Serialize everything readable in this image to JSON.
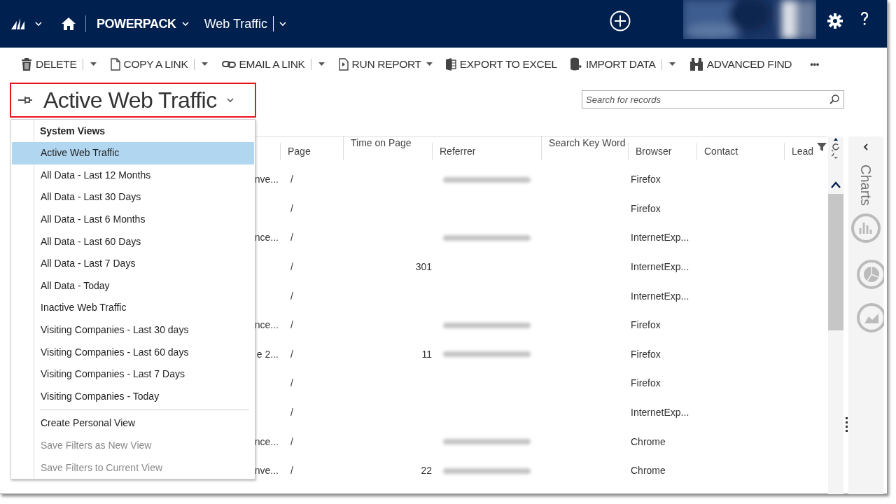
{
  "nav": {
    "app": "POWERPACK",
    "area": "Web Traffic"
  },
  "commands": [
    {
      "label": "DELETE",
      "split": true,
      "caret": false
    },
    {
      "label": "COPY A LINK",
      "split": true,
      "caret": false
    },
    {
      "label": "EMAIL A LINK",
      "split": true,
      "caret": false
    },
    {
      "label": "RUN REPORT",
      "split": false,
      "caret": true
    },
    {
      "label": "EXPORT TO EXCEL",
      "split": false,
      "caret": false
    },
    {
      "label": "IMPORT DATA",
      "split": true,
      "caret": false
    },
    {
      "label": "ADVANCED FIND",
      "split": false,
      "caret": false
    }
  ],
  "more": "•••",
  "view_title": "Active Web Traffic",
  "search": {
    "placeholder": "Search for records"
  },
  "columns": [
    "Page",
    "Time on Page",
    "Referrer",
    "Search Key Word",
    "Browser",
    "Contact",
    "Lead"
  ],
  "rows": [
    {
      "name": "nve...",
      "page": "/",
      "time": "",
      "referrer_blurred": true,
      "browser": "Firefox"
    },
    {
      "name": "",
      "page": "/",
      "time": "",
      "referrer_blurred": false,
      "browser": "Firefox"
    },
    {
      "name": "nce...",
      "page": "/",
      "time": "",
      "referrer_blurred": true,
      "browser": "InternetExp..."
    },
    {
      "name": "",
      "page": "/",
      "time": "301",
      "referrer_blurred": false,
      "browser": "InternetExp..."
    },
    {
      "name": "",
      "page": "/",
      "time": "",
      "referrer_blurred": false,
      "browser": "InternetExp..."
    },
    {
      "name": "nce...",
      "page": "/",
      "time": "",
      "referrer_blurred": true,
      "browser": "Firefox"
    },
    {
      "name": "e 2...",
      "page": "/",
      "time": "11",
      "referrer_blurred": true,
      "browser": "Firefox"
    },
    {
      "name": "",
      "page": "/",
      "time": "",
      "referrer_blurred": false,
      "browser": "Firefox"
    },
    {
      "name": "",
      "page": "/",
      "time": "",
      "referrer_blurred": false,
      "browser": "InternetExp..."
    },
    {
      "name": "nce...",
      "page": "/",
      "time": "",
      "referrer_blurred": true,
      "browser": "Chrome"
    },
    {
      "name": "nve...",
      "page": "/",
      "time": "22",
      "referrer_blurred": true,
      "browser": "Chrome"
    }
  ],
  "view_menu": {
    "groups": [
      {
        "header": "System Views",
        "items": [
          {
            "label": "Active Web Traffic",
            "selected": true,
            "disabled": false
          },
          {
            "label": "All Data - Last 12 Months",
            "selected": false,
            "disabled": false
          },
          {
            "label": "All Data - Last 30 Days",
            "selected": false,
            "disabled": false
          },
          {
            "label": "All Data - Last 6 Months",
            "selected": false,
            "disabled": false
          },
          {
            "label": "All Data - Last 60 Days",
            "selected": false,
            "disabled": false
          },
          {
            "label": "All Data - Last 7 Days",
            "selected": false,
            "disabled": false
          },
          {
            "label": "All Data - Today",
            "selected": false,
            "disabled": false
          },
          {
            "label": "Inactive Web Traffic",
            "selected": false,
            "disabled": false
          },
          {
            "label": "Visiting Companies - Last 30 days",
            "selected": false,
            "disabled": false
          },
          {
            "label": "Visiting Companies - Last 60 days",
            "selected": false,
            "disabled": false
          },
          {
            "label": "Visiting Companies - Last 7 Days",
            "selected": false,
            "disabled": false
          },
          {
            "label": "Visiting Companies - Today",
            "selected": false,
            "disabled": false
          }
        ]
      },
      {
        "items": [
          {
            "label": "Create Personal View",
            "selected": false,
            "disabled": false
          },
          {
            "label": "Save Filters as New View",
            "selected": false,
            "disabled": true
          },
          {
            "label": "Save Filters to Current View",
            "selected": false,
            "disabled": true
          }
        ]
      }
    ]
  },
  "charts_pane": {
    "title": "Charts"
  }
}
